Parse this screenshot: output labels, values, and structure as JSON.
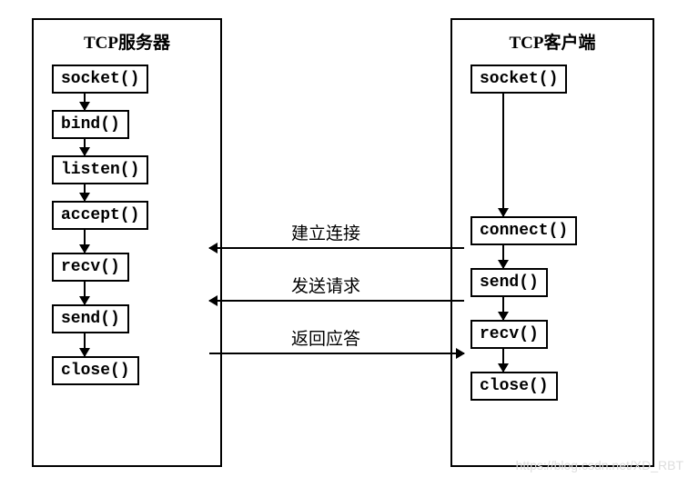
{
  "server": {
    "title": "TCP服务器",
    "steps": [
      "socket()",
      "bind()",
      "listen()",
      "accept()",
      "recv()",
      "send()",
      "close()"
    ]
  },
  "client": {
    "title": "TCP客户端",
    "steps": [
      "socket()",
      "connect()",
      "send()",
      "recv()",
      "close()"
    ]
  },
  "connections": {
    "establish": "建立连接",
    "request": "发送请求",
    "response": "返回应答"
  },
  "watermark": "https://blog.csdn.net/XD_RBT"
}
